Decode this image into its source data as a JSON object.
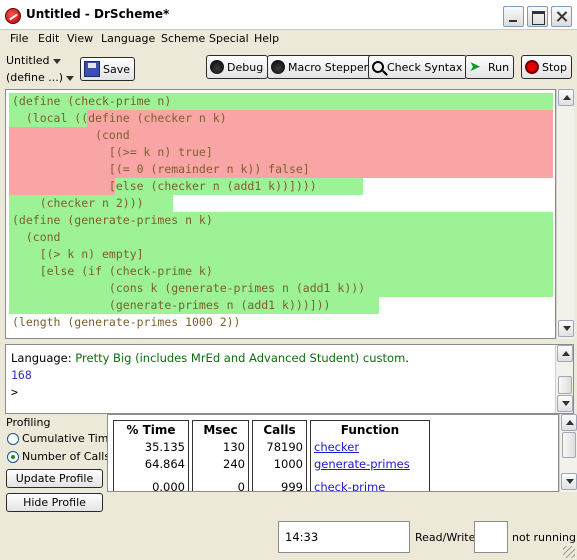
{
  "window": {
    "title": "Untitled - DrScheme*"
  },
  "menubar": [
    "File",
    "Edit",
    "View",
    "Language",
    "Scheme",
    "Special",
    "Help"
  ],
  "toolbar": {
    "file_dropdown": "Untitled",
    "define_dropdown": "(define ...)",
    "save_label": "Save",
    "debug_label": "Debug",
    "macro_label": "Macro Stepper",
    "check_label": "Check Syntax",
    "run_label": "Run",
    "stop_label": "Stop"
  },
  "editor": {
    "lines": [
      "(define (check-prime n)",
      "  (local ((define (checker n k)",
      "            (cond",
      "              [(>= k n) true]",
      "              [(= 0 (remainder n k)) false]",
      "              [else (checker n (add1 k))])))",
      "    (checker n 2)))",
      "(define (generate-primes n k)",
      "  (cond",
      "    [(> k n) empty]",
      "    [else (if (check-prime k)",
      "              (cons k (generate-primes n (add1 k)))",
      "              (generate-primes n (add1 k)))]))",
      "(length (generate-primes 1000 2))"
    ],
    "highlight_green": "#9cf294",
    "highlight_red": "#f9a5a5"
  },
  "interactions": {
    "language_prefix": "Language: ",
    "language_name": "Pretty Big (includes MrEd and Advanced Student) custom",
    "language_suffix": ".",
    "result": "168",
    "prompt": ">"
  },
  "profiling": {
    "title": "Profiling",
    "modes": [
      "Cumulative Time",
      "Number of Calls"
    ],
    "selected_mode": "Number of Calls",
    "update_button": "Update Profile",
    "hide_button": "Hide Profile",
    "columns": [
      "% Time",
      "Msec",
      "Calls",
      "Function"
    ],
    "rows": [
      {
        "pct": "35.135",
        "msec": "130",
        "calls": "78190",
        "fn": "checker"
      },
      {
        "pct": "64.864",
        "msec": "240",
        "calls": "1000",
        "fn": "generate-primes"
      },
      {
        "pct": "0.000",
        "msec": "0",
        "calls": "999",
        "fn": "check-prime"
      }
    ]
  },
  "status": {
    "time": "14:33",
    "read_write": "Read/Write",
    "running": "not running"
  }
}
